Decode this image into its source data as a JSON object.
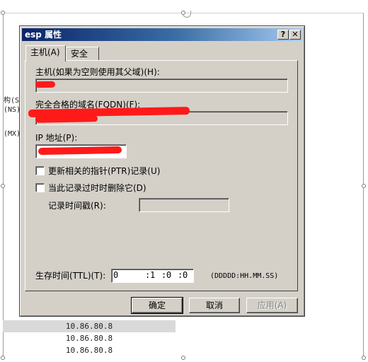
{
  "background": {
    "left_labels": [
      "构(S",
      "(NS)",
      "(MX)"
    ],
    "ip_rows": [
      "10.86.80.8",
      "10.86.80.8",
      "10.86.80.8"
    ]
  },
  "dialog": {
    "title": "esp 属性",
    "help_button": "?",
    "close_button": "✕",
    "tabs": [
      "主机(A)",
      "安全"
    ],
    "host_label": "主机(如果为空则使用其父域)(H):",
    "fqdn_label": "完全合格的域名(FQDN)(F):",
    "ip_label": "IP 地址(P):",
    "ptr_checkbox_label": "更新相关的指针(PTR)记录(U)",
    "delete_stale_checkbox_label": "当此记录过时时删除它(D)",
    "timestamp_label": "记录时间戳(R):",
    "ttl_label": "生存时间(TTL)(T):",
    "ttl_days": "0",
    "ttl_hours": "1",
    "ttl_minutes": "0",
    "ttl_seconds": "0",
    "ttl_separator": ":",
    "ttl_format": "(DDDDD:HH.MM.SS)",
    "buttons": {
      "ok": "确定",
      "cancel": "取消",
      "apply": "应用(A)"
    }
  }
}
